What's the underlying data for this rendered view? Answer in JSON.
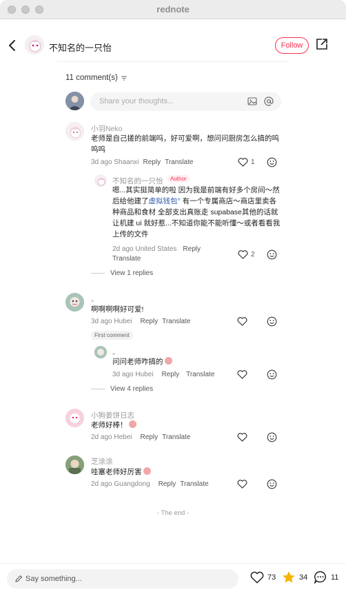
{
  "window": {
    "title": "rednote"
  },
  "header": {
    "author_name": "不知名的一只怡",
    "follow_label": "Follow"
  },
  "comments_header": {
    "count_label": "11 comment(s)"
  },
  "composer": {
    "placeholder": "Share your thoughts..."
  },
  "comments": [
    {
      "nickname": "小羽Neko",
      "text": "老师是自己搓的前端吗，好可爱啊，想问问厨房怎么搞的呜呜呜",
      "meta": "3d ago Shaanxi",
      "reply_label": "Reply",
      "translate_label": "Translate",
      "likes": "1",
      "replies": [
        {
          "nickname": "不知名的一只怡",
          "tag": "Author",
          "text_before": "嗯...其实挺简单的啦 因为我是前端有好多个房间～然后给他建了",
          "link": "虚拟钱包°",
          "text_after": " 有一个专属商店～商店里卖各种商品和食材 全部支出真账走 supabase其他的话就让机建 ui 就好惹...不知道你能不能听懂～或者看看我上传的文件",
          "meta": "2d ago United States",
          "reply_label": "Reply",
          "translate_label": "Translate",
          "likes": "2"
        }
      ],
      "view_replies": "View 1 replies"
    },
    {
      "nickname": "。",
      "text": "啊啊啊啊好可爱!",
      "meta": "3d ago Hubei",
      "reply_label": "Reply",
      "translate_label": "Translate",
      "likes": "",
      "badge": "First comment",
      "replies": [
        {
          "nickname": "。",
          "text": "问问老师咋搞的",
          "meta": "3d ago Hubei",
          "reply_label": "Reply",
          "translate_label": "Translate",
          "likes": ""
        }
      ],
      "view_replies": "View 4 replies"
    },
    {
      "nickname": "小狗姜饼日志",
      "text": "老师好棒！",
      "meta": "2d ago Hebei",
      "reply_label": "Reply",
      "translate_label": "Translate",
      "likes": ""
    },
    {
      "nickname": "芝涂涂",
      "text": "哇塞老师好厉害",
      "meta": "2d ago Guangdong",
      "reply_label": "Reply",
      "translate_label": "Translate",
      "likes": ""
    }
  ],
  "end_label": "- The end -",
  "bottom_bar": {
    "placeholder": "Say something...",
    "likes": "73",
    "collects": "34",
    "comments": "11"
  },
  "colors": {
    "accent": "#ff2e4d",
    "link": "#2d5aa8",
    "star": "#f5b400"
  },
  "icons": [
    "back-icon",
    "share-icon",
    "sort-icon",
    "image-icon",
    "at-icon",
    "heart-icon",
    "emoji-icon",
    "pen-icon",
    "star-icon",
    "comment-icon"
  ]
}
